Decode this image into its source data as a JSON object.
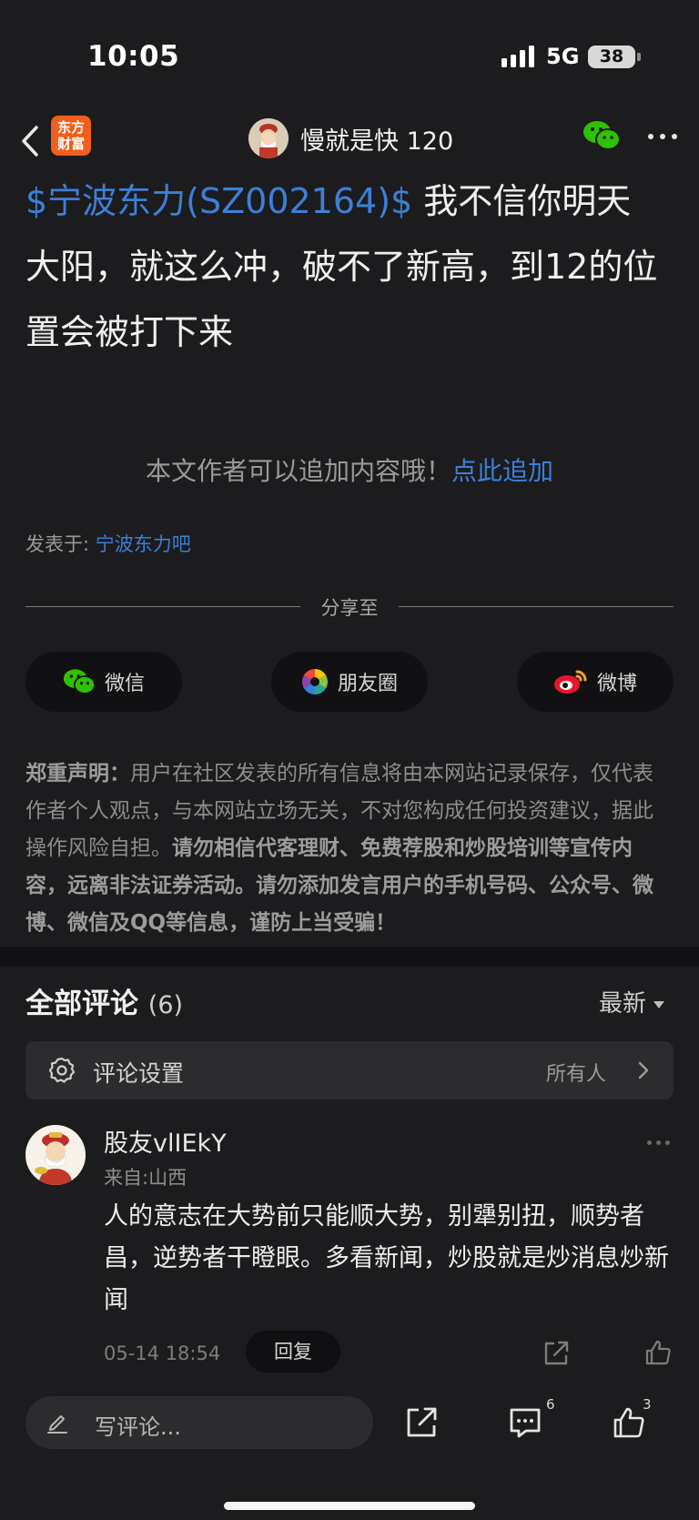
{
  "status_bar": {
    "time": "10:05",
    "network": "5G",
    "battery": "38"
  },
  "nav": {
    "app_logo_line1": "东方",
    "app_logo_line2": "财富",
    "author": "慢就是快 120"
  },
  "post": {
    "stock_tag": "$宁波东力(SZ002164)$",
    "text": "  我不信你明天大阳，就这么冲，破不了新高，到12的位置会被打下来",
    "append_hint": "本文作者可以追加内容哦！",
    "append_link": "点此追加",
    "posted_in_label": "发表于: ",
    "forum": "宁波东力吧"
  },
  "share": {
    "label": "分享至",
    "wechat": "微信",
    "moments": "朋友圈",
    "weibo": "微博"
  },
  "disclaimer": {
    "title": "郑重声明：",
    "text": "用户在社区发表的所有信息将由本网站记录保存，仅代表作者个人观点，与本网站立场无关，不对您构成任何投资建议，据此操作风险自担。",
    "warning": "请勿相信代客理财、免费荐股和炒股培训等宣传内容，远离非法证券活动。请勿添加发言用户的手机号码、公众号、微博、微信及QQ等信息，谨防上当受骗！"
  },
  "comments": {
    "title": "全部评论",
    "count": "(6)",
    "sort": "最新",
    "settings_label": "评论设置",
    "settings_value": "所有人",
    "items": [
      {
        "user": "股友vlIEkY",
        "location": "来自:山西",
        "text": "人的意志在大势前只能顺大势，别犟别扭，顺势者昌，逆势者干瞪眼。多看新闻，炒股就是炒消息炒新闻",
        "time": "05-14 18:54",
        "reply": "回复"
      }
    ]
  },
  "bottom_bar": {
    "placeholder": "写评论...",
    "comment_count": "6",
    "like_count": "3"
  },
  "colors": {
    "link": "#3d7fd6",
    "background": "#1c1c1e",
    "logo": "#f25f1c"
  }
}
